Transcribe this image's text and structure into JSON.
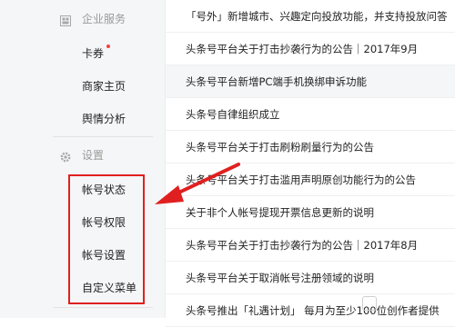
{
  "sidebar": {
    "enterprise_section": {
      "icon": "enterprise-service-icon",
      "label": "企业服务"
    },
    "enterprise_items": [
      {
        "label": "卡券",
        "has_badge": true
      },
      {
        "label": "商家主页"
      },
      {
        "label": "舆情分析"
      }
    ],
    "settings_section": {
      "icon": "gear-icon",
      "label": "设置"
    },
    "settings_items": [
      {
        "label": "帐号状态"
      },
      {
        "label": "帐号权限"
      },
      {
        "label": "帐号设置"
      },
      {
        "label": "自定义菜单"
      }
    ]
  },
  "notices": [
    {
      "title": "「号外」新增城市、兴趣定向投放功能，并支持投放问答"
    },
    {
      "title": "头条号平台关于打击抄袭行为的公告｜2017年9月"
    },
    {
      "title": "头条号平台新增PC端手机换绑申诉功能"
    },
    {
      "title": "头条号自律组织成立"
    },
    {
      "title": "头条号平台关于打击刷粉刷量行为的公告"
    },
    {
      "title": "头条号平台关于打击滥用声明原创功能行为的公告"
    },
    {
      "title": "关于非个人帐号提现开票信息更新的说明"
    },
    {
      "title": "头条号平台关于打击抄袭行为的公告｜2017年8月"
    },
    {
      "title": "头条号平台关于取消帐号注册领域的说明"
    },
    {
      "title": "头条号推出「礼遇计划」 每月为至少100位创作者提供"
    }
  ],
  "colors": {
    "annotation_red": "#e02020",
    "sidebar_bg": "#f5f6f7",
    "badge_red": "#f04142"
  }
}
